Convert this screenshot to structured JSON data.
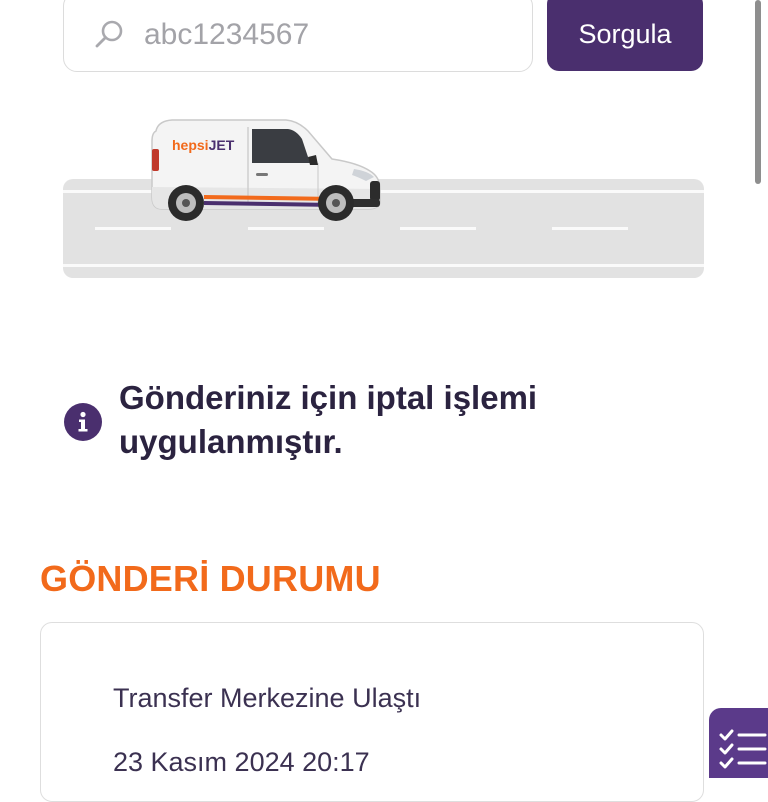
{
  "search": {
    "value": "",
    "placeholder": "abc1234567",
    "button_label": "Sorgula"
  },
  "illustration": {
    "brand_prefix": "hepsi",
    "brand_suffix": "JET"
  },
  "notice": {
    "icon": "info-icon",
    "message": "Gönderiniz için iptal işlemi uygulanmıştır."
  },
  "shipment_status": {
    "section_title": "GÖNDERİ DURUMU",
    "events": [
      {
        "title": "Transfer Merkezine Ulaştı",
        "datetime": "23 Kasım 2024 20:17"
      }
    ]
  },
  "colors": {
    "primary": "#4a2f6e",
    "accent": "#f26a1b",
    "text": "#2b2340"
  }
}
